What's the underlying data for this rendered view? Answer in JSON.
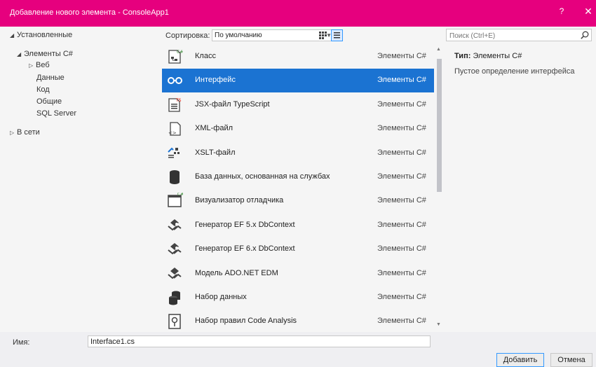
{
  "window": {
    "title": "Добавление нового элемента - ConsoleApp1",
    "help_glyph": "?",
    "close_glyph": "✕"
  },
  "tree": {
    "installed": "Установленные",
    "csharp_items": "Элементы C#",
    "web": "Веб",
    "data": "Данные",
    "code": "Код",
    "general": "Общие",
    "sql_server": "SQL Server",
    "online": "В сети"
  },
  "toolbar": {
    "sort_label": "Сортировка:",
    "sort_value": "По умолчанию"
  },
  "templates": [
    {
      "name": "Класс",
      "category": "Элементы C#",
      "icon": "class-icon"
    },
    {
      "name": "Интерфейс",
      "category": "Элементы C#",
      "icon": "interface-icon"
    },
    {
      "name": "JSX-файл TypeScript",
      "category": "Элементы C#",
      "icon": "typescript-file-icon"
    },
    {
      "name": "XML-файл",
      "category": "Элементы C#",
      "icon": "xml-file-icon"
    },
    {
      "name": "XSLT-файл",
      "category": "Элементы C#",
      "icon": "xslt-file-icon"
    },
    {
      "name": "База данных, основанная на службах",
      "category": "Элементы C#",
      "icon": "database-icon"
    },
    {
      "name": "Визуализатор отладчика",
      "category": "Элементы C#",
      "icon": "debugger-visualizer-icon"
    },
    {
      "name": "Генератор EF 5.x DbContext",
      "category": "Элементы C#",
      "icon": "ef-generator-icon"
    },
    {
      "name": "Генератор EF 6.x DbContext",
      "category": "Элементы C#",
      "icon": "ef-generator-icon"
    },
    {
      "name": "Модель ADO.NET EDM",
      "category": "Элементы C#",
      "icon": "ado-model-icon"
    },
    {
      "name": "Набор данных",
      "category": "Элементы C#",
      "icon": "dataset-icon"
    },
    {
      "name": "Набор правил Code Analysis",
      "category": "Элементы C#",
      "icon": "code-analysis-ruleset-icon"
    }
  ],
  "selected_index": 1,
  "search": {
    "placeholder": "Поиск (Ctrl+E)"
  },
  "details": {
    "type_label": "Тип:",
    "type_value": "Элементы C#",
    "description": "Пустое определение интерфейса"
  },
  "footer": {
    "name_label": "Имя:",
    "name_value": "Interface1.cs",
    "add_label": "Добавить",
    "cancel_label": "Отмена"
  },
  "colors": {
    "titlebar": "#e6007e",
    "selection": "#1b73d2",
    "accent": "#3399ff"
  }
}
